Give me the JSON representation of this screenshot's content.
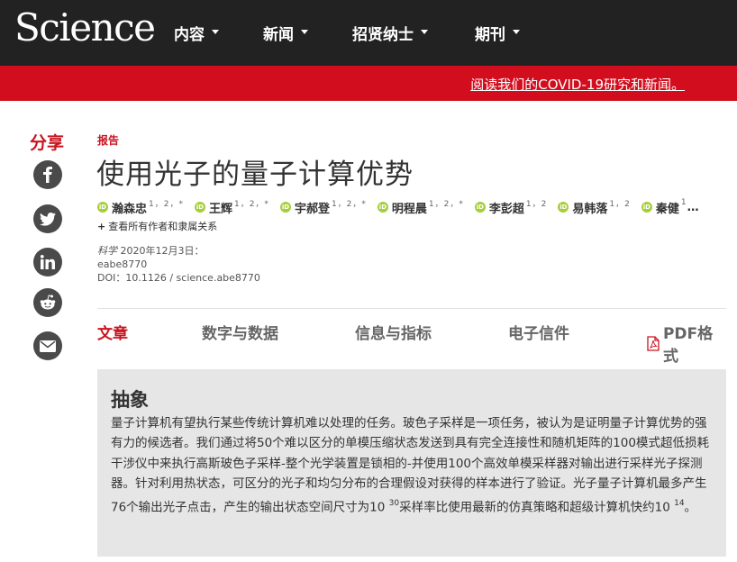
{
  "header": {
    "logo": "Science",
    "nav": [
      {
        "label": "内容"
      },
      {
        "label": "新闻"
      },
      {
        "label": "招贤纳士"
      },
      {
        "label": "期刊"
      }
    ]
  },
  "banner": {
    "link_text": "阅读我们的COVID-19研究和新闻。"
  },
  "share": {
    "title": "分享",
    "icons": [
      "facebook-icon",
      "twitter-icon",
      "linkedin-icon",
      "reddit-icon",
      "email-icon"
    ]
  },
  "article": {
    "type": "报告",
    "title": "使用光子的量子计算优势",
    "authors": [
      {
        "name": "瀚森忠",
        "sup": "1，2，*"
      },
      {
        "name": "王辉",
        "sup": "1，2，*"
      },
      {
        "name": "宇郝登",
        "sup": "1，2，*"
      },
      {
        "name": "明程晨",
        "sup": "1，2，*"
      },
      {
        "name": "李彭超",
        "sup": "1，2"
      },
      {
        "name": "易韩落",
        "sup": "1，2"
      },
      {
        "name": "秦健",
        "sup": "1"
      }
    ],
    "authors_ellipsis": "…",
    "show_all": "查看所有作者和隶属关系",
    "journal": "科学",
    "date": " 2020年12月3日：",
    "article_id": "eabe8770",
    "doi": "DOI：10.1126 / science.abe8770"
  },
  "tabs": [
    {
      "label": "文章",
      "active": true
    },
    {
      "label": "数字与数据"
    },
    {
      "label": "信息与指标"
    },
    {
      "label": "电子信件"
    },
    {
      "label": "PDF格式"
    }
  ],
  "abstract": {
    "heading": "抽象",
    "text_before_sup1": "量子计算机有望执行某些传统计算机难以处理的任务。玻色子采样是一项任务，被认为是证明量子计算优势的强有力的候选者。我们通过将50个难以区分的单模压缩状态发送到具有完全连接性和随机矩阵的100模式超低损耗干涉仪中来执行高斯玻色子采样-整个光学装置是锁相的-并使用100个高效单模采样器对输出进行采样光子探测器。针对利用热状态，可区分的光子和均匀分布的合理假设对获得的样本进行了验证。光子量子计算机最多产生76个输出光子点击，产生的输出状态空间尺寸为10 ",
    "sup1": "30",
    "text_mid": "采样率比使用最新的仿真策略和超级计算机快约10 ",
    "sup2": "14",
    "text_end": "。"
  },
  "colors": {
    "header_bg": "#222222",
    "banner_red": "#d20e1e",
    "accent_red": "#c9141f",
    "orcid_green": "#a6ce39",
    "abstract_bg": "#e6e6e6"
  }
}
